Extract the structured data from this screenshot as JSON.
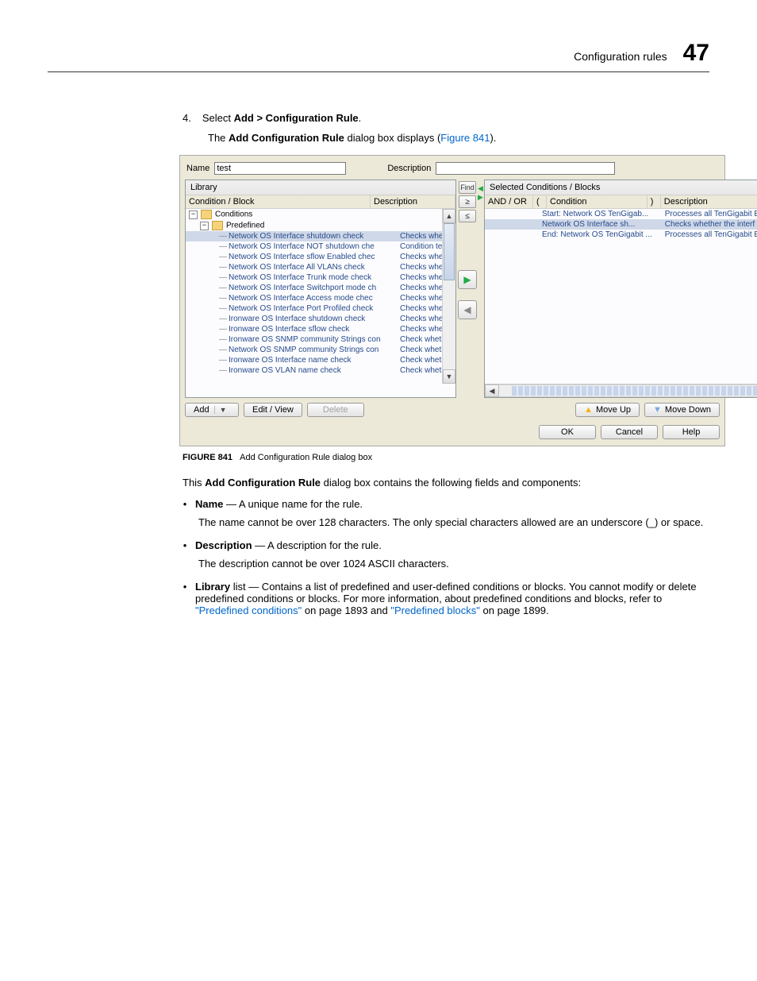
{
  "header": {
    "title": "Configuration rules",
    "page_number": "47"
  },
  "step": {
    "number": "4.",
    "prefix": "Select ",
    "bold": "Add > Configuration Rule",
    "suffix": "."
  },
  "step_sub": {
    "prefix": "The ",
    "bold": "Add Configuration Rule",
    "mid": " dialog box displays (",
    "link": "Figure 841",
    "suffix": ")."
  },
  "dialog": {
    "name_label": "Name",
    "name_value": "test",
    "desc_label": "Description",
    "desc_value": "",
    "library_label": "Library",
    "selected_label": "Selected Conditions / Blocks",
    "left_headers": {
      "c1": "Condition / Block",
      "c2": "Description"
    },
    "right_headers": {
      "r1": "AND / OR",
      "rp1": "(",
      "r2": "Condition",
      "rp2": ")",
      "r3": "Description"
    },
    "find_label": "Find",
    "btn_search": "≥",
    "btn_search2": "≤",
    "arrow_right": "▶",
    "arrow_left": "◀",
    "tree": [
      {
        "type": "root",
        "label": "Conditions"
      },
      {
        "type": "folder",
        "label": "Predefined"
      },
      {
        "type": "leaf-sel",
        "label": "Network OS Interface shutdown check",
        "desc": "Checks whether..."
      },
      {
        "type": "leaf",
        "label": "Network OS Interface NOT shutdown che",
        "desc": "Condition test fai..."
      },
      {
        "type": "leaf",
        "label": "Network OS Interface sflow Enabled chec",
        "desc": "Checks whether..."
      },
      {
        "type": "leaf",
        "label": "Network OS Interface All VLANs check",
        "desc": "Checks whether..."
      },
      {
        "type": "leaf",
        "label": "Network OS Interface Trunk mode check",
        "desc": "Checks whether..."
      },
      {
        "type": "leaf",
        "label": "Network OS Interface Switchport mode ch",
        "desc": "Checks whether..."
      },
      {
        "type": "leaf",
        "label": "Network OS Interface Access mode chec",
        "desc": "Checks whether..."
      },
      {
        "type": "leaf",
        "label": "Network OS Interface Port Profiled check",
        "desc": "Checks whether..."
      },
      {
        "type": "leaf",
        "label": "Ironware OS Interface shutdown check",
        "desc": "Checks whether..."
      },
      {
        "type": "leaf",
        "label": "Ironware OS Interface sflow check",
        "desc": "Checks whether..."
      },
      {
        "type": "leaf",
        "label": "Ironware OS SNMP community Strings con",
        "desc": "Check whether ..."
      },
      {
        "type": "leaf",
        "label": "Network OS SNMP community Strings con",
        "desc": "Check whether ..."
      },
      {
        "type": "leaf",
        "label": "Ironware OS Interface name check",
        "desc": "Check whether t..."
      },
      {
        "type": "leaf",
        "label": "Ironware OS VLAN name check",
        "desc": "Check whether t..."
      }
    ],
    "rows": [
      {
        "andor": "",
        "cond": "Start: Network OS TenGigab...",
        "desc": "Processes all TenGigabit E"
      },
      {
        "andor": "",
        "cond": "Network OS Interface sh...",
        "desc": "Checks whether the interf",
        "sel": true
      },
      {
        "andor": "",
        "cond": "End: Network OS TenGigabit ...",
        "desc": "Processes all TenGigabit E"
      }
    ],
    "buttons": {
      "add": "Add",
      "edit": "Edit / View",
      "delete": "Delete",
      "move_up": "Move Up",
      "move_down": "Move Down",
      "ok": "OK",
      "cancel": "Cancel",
      "help": "Help"
    }
  },
  "caption": {
    "label": "FIGURE 841",
    "text": "Add Configuration Rule dialog box"
  },
  "intro": {
    "prefix": "This ",
    "bold": "Add Configuration Rule",
    "suffix": " dialog box contains the following fields and components:"
  },
  "bullets": {
    "name": {
      "bold": "Name",
      "rest": " — A unique name for the rule.",
      "sub": "The name cannot be over 128 characters. The only special characters allowed are an underscore (_) or space."
    },
    "desc": {
      "bold": "Description",
      "rest": " — A description for the rule.",
      "sub": "The description cannot be over 1024 ASCII characters."
    },
    "library": {
      "bold": "Library",
      "rest": " list — Contains a list of predefined and user-defined conditions or blocks. You cannot modify or delete predefined conditions or blocks. For more information, about predefined conditions and blocks, refer to ",
      "link1": "\"Predefined conditions\"",
      "mid1": " on page 1893 and ",
      "link2": "\"Predefined blocks\"",
      "mid2": " on page 1899."
    }
  }
}
